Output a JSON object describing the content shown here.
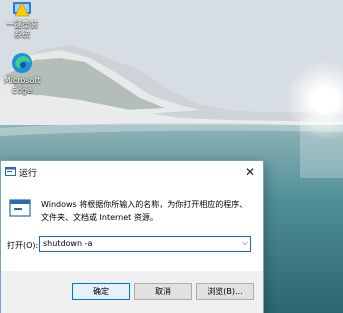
{
  "desktop": {
    "icons": [
      {
        "label_line1": "一键重装",
        "label_line2": "系统",
        "icon": "repair-tool-icon"
      },
      {
        "label_line1": "Microsoft",
        "label_line2": "Edge",
        "icon": "edge-icon"
      }
    ]
  },
  "run_dialog": {
    "title": "运行",
    "close_glyph": "✕",
    "description_line1": "Windows 将根据你所输入的名称，为你打开相应的程序、",
    "description_line2": "文件夹、文档或 Internet 资源。",
    "open_label": "打开(O):",
    "command_value": "shutdown -a",
    "dropdown_glyph": "⌵",
    "buttons": {
      "ok": "确定",
      "cancel": "取消",
      "browse": "浏览(B)..."
    }
  },
  "colors": {
    "accent": "#0078d7",
    "dialog_bg": "#f0f0f0"
  }
}
